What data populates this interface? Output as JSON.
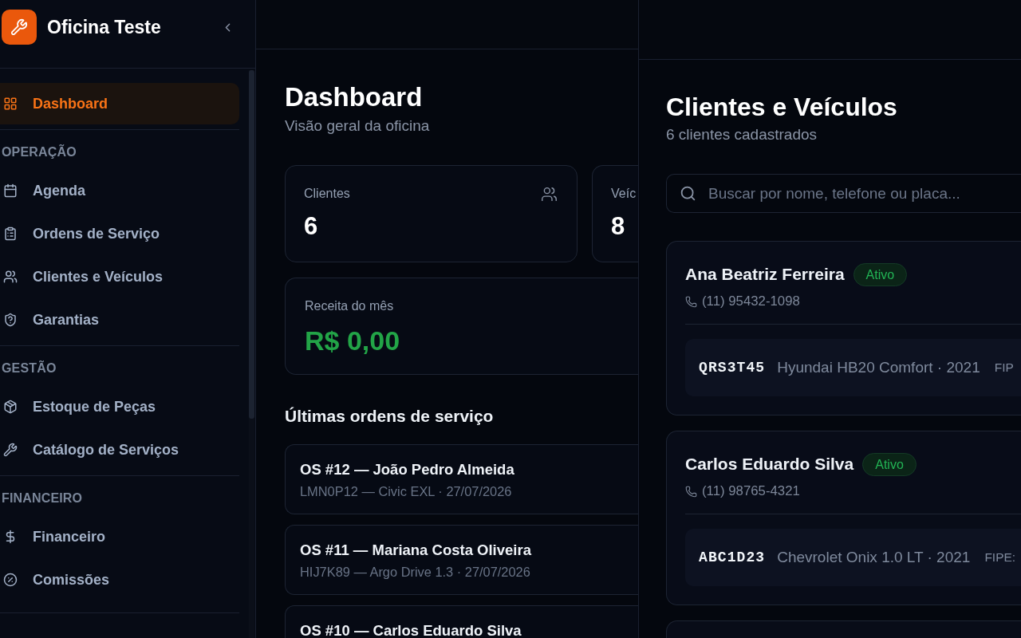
{
  "sidebar": {
    "brand": "Oficina Teste",
    "groups": [
      {
        "items": [
          {
            "label": "Dashboard",
            "selected": true
          }
        ]
      },
      {
        "heading": "OPERAÇÃO",
        "items": [
          {
            "label": "Agenda",
            "selected": false
          },
          {
            "label": "Ordens de Serviço",
            "selected": false
          },
          {
            "label": "Clientes e Veículos",
            "selected": false
          },
          {
            "label": "Garantias",
            "selected": false
          }
        ]
      },
      {
        "heading": "GESTÃO",
        "items": [
          {
            "label": "Estoque de Peças",
            "selected": false
          },
          {
            "label": "Catálogo de Serviços",
            "selected": false
          }
        ]
      },
      {
        "heading": "FINANCEIRO",
        "items": [
          {
            "label": "Financeiro",
            "selected": false
          },
          {
            "label": "Comissões",
            "selected": false
          }
        ]
      }
    ]
  },
  "dashboard": {
    "title": "Dashboard",
    "subtitle": "Visão geral da oficina",
    "stats": [
      {
        "label": "Clientes",
        "value": "6"
      },
      {
        "label": "Veíc",
        "value": "8"
      }
    ],
    "revenue": {
      "label": "Receita do mês",
      "value": "R$ 0,00"
    },
    "recent_orders": {
      "heading": "Últimas ordens de serviço",
      "items": [
        {
          "title": "OS #12 — João Pedro Almeida",
          "detail": "LMN0P12 — Civic EXL · 27/07/2026"
        },
        {
          "title": "OS #11 — Mariana Costa Oliveira",
          "detail": "HIJ7K89 — Argo Drive 1.3 · 27/07/2026"
        },
        {
          "title": "OS #10 — Carlos Eduardo Silva"
        }
      ]
    }
  },
  "clients_panel": {
    "title": "Clientes e Veículos",
    "subtitle": "6 clientes cadastrados",
    "search": {
      "placeholder": "Buscar por nome, telefone ou placa..."
    },
    "clients": [
      {
        "name": "Ana Beatriz Ferreira",
        "status": "Ativo",
        "phone": "(11) 95432-1098",
        "vehicles": [
          {
            "plate": "QRS3T45",
            "model": "Hyundai HB20 Comfort · 2021",
            "fipe": "FIP"
          }
        ]
      },
      {
        "name": "Carlos Eduardo Silva",
        "status": "Ativo",
        "phone": "(11) 98765-4321",
        "vehicles": [
          {
            "plate": "ABC1D23",
            "model": "Chevrolet Onix 1.0 LT · 2021",
            "fipe": "FIPE:"
          }
        ]
      }
    ]
  }
}
